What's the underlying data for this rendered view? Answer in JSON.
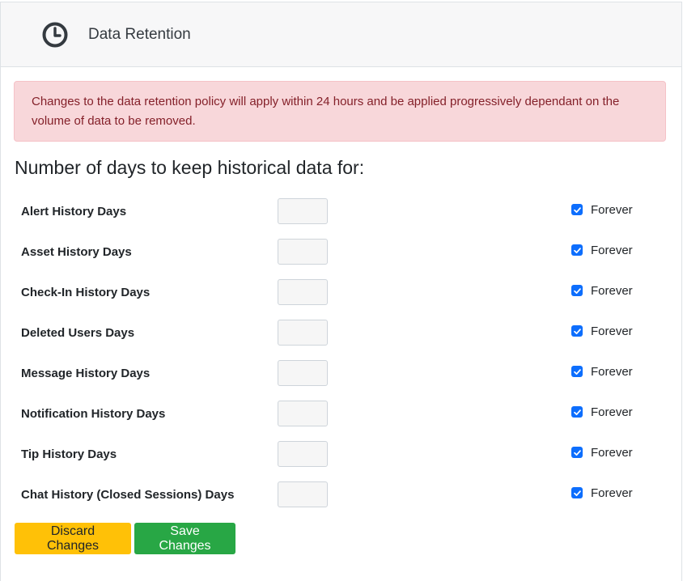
{
  "header": {
    "icon": "clock-icon",
    "title": "Data Retention"
  },
  "alert": {
    "text": "Changes to the data retention policy will apply within 24 hours and be applied progressively dependant on the volume of data to be removed."
  },
  "section": {
    "title": "Number of days to keep historical data for:"
  },
  "rows": [
    {
      "label": "Alert History Days",
      "value": "",
      "forever_label": "Forever",
      "forever_checked": true
    },
    {
      "label": "Asset History Days",
      "value": "",
      "forever_label": "Forever",
      "forever_checked": true
    },
    {
      "label": "Check-In History Days",
      "value": "",
      "forever_label": "Forever",
      "forever_checked": true
    },
    {
      "label": "Deleted Users Days",
      "value": "",
      "forever_label": "Forever",
      "forever_checked": true
    },
    {
      "label": "Message History Days",
      "value": "",
      "forever_label": "Forever",
      "forever_checked": true
    },
    {
      "label": "Notification History Days",
      "value": "",
      "forever_label": "Forever",
      "forever_checked": true
    },
    {
      "label": "Tip History Days",
      "value": "",
      "forever_label": "Forever",
      "forever_checked": true
    },
    {
      "label": "Chat History (Closed Sessions) Days",
      "value": "",
      "forever_label": "Forever",
      "forever_checked": true
    }
  ],
  "buttons": {
    "discard_label": "Discard Changes",
    "save_label": "Save Changes"
  },
  "colors": {
    "alert_bg": "#f8d7da",
    "alert_text": "#842029",
    "checkbox": "#0d6efd",
    "discard": "#ffc107",
    "save": "#28a745"
  }
}
